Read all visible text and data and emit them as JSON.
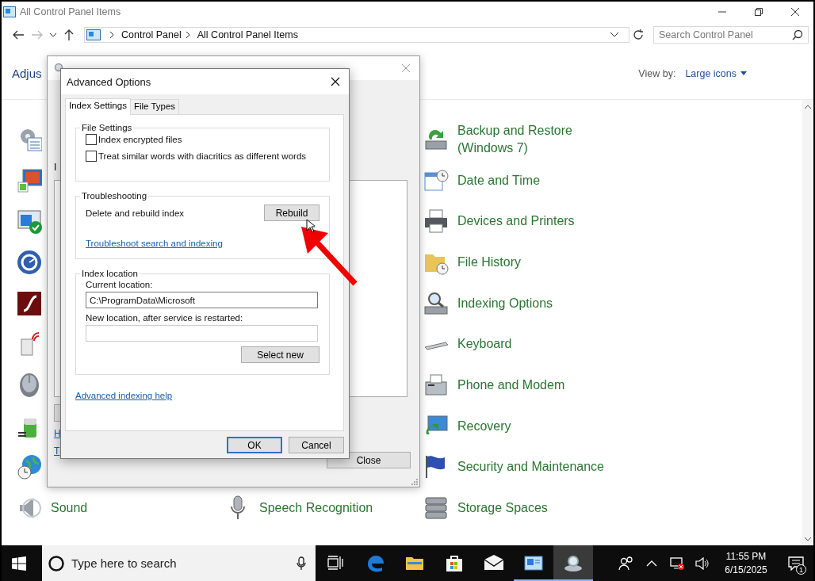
{
  "window": {
    "title": "All Control Panel Items",
    "breadcrumbs": [
      "Control Panel",
      "All Control Panel Items"
    ],
    "search_placeholder": "Search Control Panel"
  },
  "header": {
    "title": "Adjus",
    "view_by_label": "View by:",
    "view_by_value": "Large icons"
  },
  "items": {
    "left": [
      {
        "kind": "covered"
      },
      {
        "kind": "covered"
      },
      {
        "kind": "covered"
      },
      {
        "kind": "covered"
      },
      {
        "kind": "covered"
      },
      {
        "kind": "covered"
      },
      {
        "kind": "covered"
      },
      {
        "kind": "covered"
      },
      {
        "kind": "covered"
      },
      {
        "kind": "item",
        "label": "Sound"
      }
    ],
    "middle": [
      {
        "kind": "item",
        "label": "Speech Recognition"
      }
    ],
    "right": [
      {
        "kind": "item",
        "label": "Backup and Restore (Windows 7)"
      },
      {
        "kind": "item",
        "label": "Date and Time"
      },
      {
        "kind": "item",
        "label": "Devices and Printers"
      },
      {
        "kind": "item",
        "label": "File History"
      },
      {
        "kind": "item",
        "label": "Indexing Options"
      },
      {
        "kind": "item",
        "label": "Keyboard"
      },
      {
        "kind": "item",
        "label": "Phone and Modem"
      },
      {
        "kind": "item",
        "label": "Recovery"
      },
      {
        "kind": "item",
        "label": "Security and Maintenance"
      },
      {
        "kind": "item",
        "label": "Storage Spaces"
      }
    ]
  },
  "indexing_window": {
    "label": "I",
    "links": [
      "H",
      "T"
    ],
    "close_button": "Close"
  },
  "advanced_dialog": {
    "title": "Advanced Options",
    "tabs": [
      {
        "label": "Index Settings",
        "selected": true
      },
      {
        "label": "File Types",
        "selected": false
      }
    ],
    "file_settings": {
      "title": "File Settings",
      "checkboxes": [
        {
          "label": "Index encrypted files",
          "checked": false
        },
        {
          "label": "Treat similar words with diacritics as different words",
          "checked": false
        }
      ]
    },
    "troubleshooting": {
      "title": "Troubleshooting",
      "text": "Delete and rebuild index",
      "button": "Rebuild",
      "link": "Troubleshoot search and indexing"
    },
    "index_location": {
      "title": "Index location",
      "current_label": "Current location:",
      "current_value": "C:\\ProgramData\\Microsoft",
      "new_label": "New location, after service is restarted:",
      "button": "Select new"
    },
    "help_link": "Advanced indexing help",
    "buttons": [
      {
        "label": "OK",
        "kind": "default"
      },
      {
        "label": "Cancel",
        "kind": "normal"
      }
    ]
  },
  "taskbar": {
    "search_placeholder": "Type here to search",
    "apps": [
      {
        "kind": "edge",
        "open": false,
        "selected": false
      },
      {
        "kind": "explorer",
        "open": false,
        "selected": false
      },
      {
        "kind": "store",
        "open": false,
        "selected": false
      },
      {
        "kind": "mail",
        "open": false,
        "selected": false
      },
      {
        "kind": "control-panel",
        "open": true,
        "selected": false
      },
      {
        "kind": "indexing",
        "open": true,
        "selected": true
      }
    ],
    "time": "11:55 PM",
    "date": "6/15/2025",
    "notification_count": "1"
  }
}
